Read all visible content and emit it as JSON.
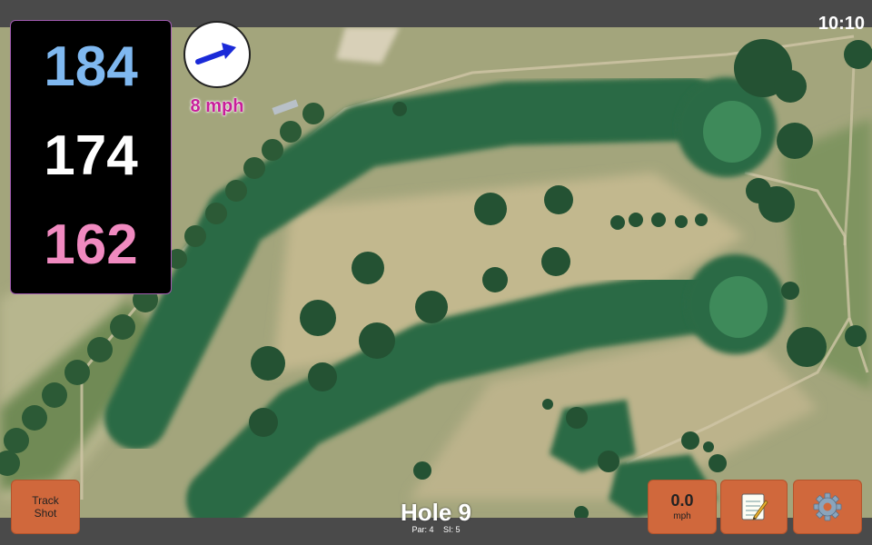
{
  "status": {
    "time": "10:10"
  },
  "distances": {
    "back": "184",
    "middle": "174",
    "front": "162"
  },
  "wind": {
    "speed_label": "8 mph",
    "icon": "wind-direction-arrow-icon"
  },
  "hole": {
    "title": "Hole 9",
    "par": "Par: 4",
    "si": "SI: 5"
  },
  "buttons": {
    "track_line1": "Track",
    "track_line2": "Shot",
    "speed_value": "0.0",
    "speed_unit": "mph",
    "notes_icon": "notepad-icon",
    "settings_icon": "gear-icon"
  },
  "colors": {
    "back_distance": "#7fb8f0",
    "middle_distance": "#ffffff",
    "front_distance": "#f08ac0",
    "button_accent": "#d0683c",
    "wind_label": "#c81e9a"
  }
}
